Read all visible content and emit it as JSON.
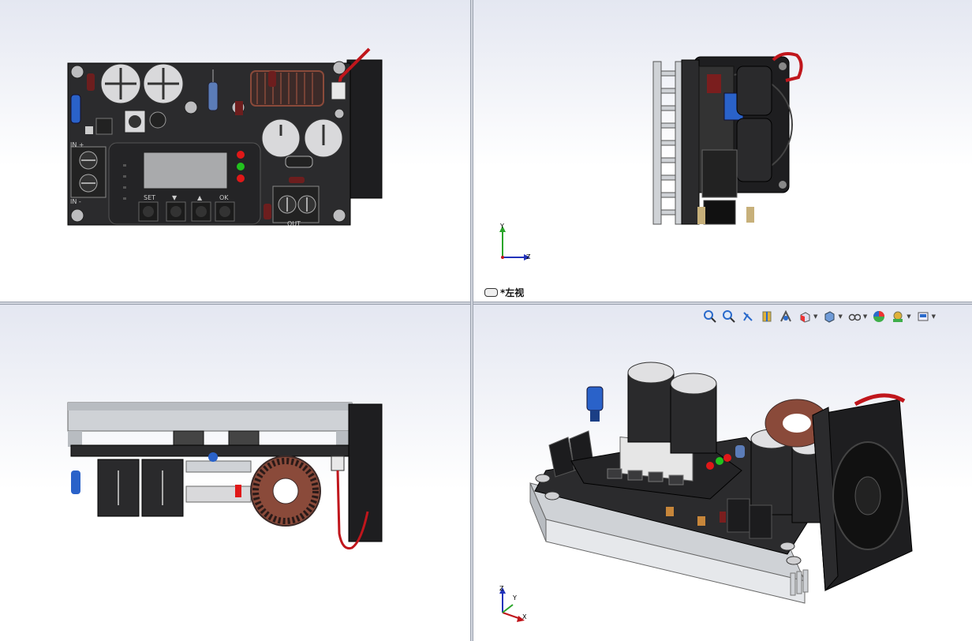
{
  "viewports": {
    "top_left": {
      "label": ""
    },
    "top_right": {
      "label": "*左视",
      "triad": {
        "y": "Y",
        "z": "Z"
      }
    },
    "bottom_left": {
      "label": ""
    },
    "bottom_right": {
      "label": "",
      "triad": {
        "z": "Z",
        "y": "Y",
        "x": "X"
      }
    }
  },
  "board": {
    "buttons": {
      "set": "SET",
      "down": "▼",
      "up": "▲",
      "ok": "OK"
    },
    "labels": {
      "in_plus": "IN +",
      "in_minus": "IN -",
      "out": "OUT"
    }
  },
  "heads_up_toolbar": {
    "tools": [
      "zoom-to-fit-icon",
      "zoom-to-area-icon",
      "previous-view-icon",
      "section-view-icon",
      "dynamic-annotation-icon",
      "view-orientation-icon",
      "display-style-icon",
      "hide-show-items-icon",
      "edit-appearance-icon",
      "apply-scene-icon",
      "view-settings-icon"
    ]
  },
  "colors": {
    "viewport_top": "#e4e7f1",
    "pcb": "#2b2b2d",
    "capacitor_cap": "#d9d9db",
    "fan": "#1e1e20",
    "heatsink": "#cfd2d6",
    "wire_red": "#c0161c",
    "toroid": "#8a4a3a",
    "led_red": "#e01818",
    "led_green": "#22c11e",
    "connector_blue": "#2a62c9"
  }
}
